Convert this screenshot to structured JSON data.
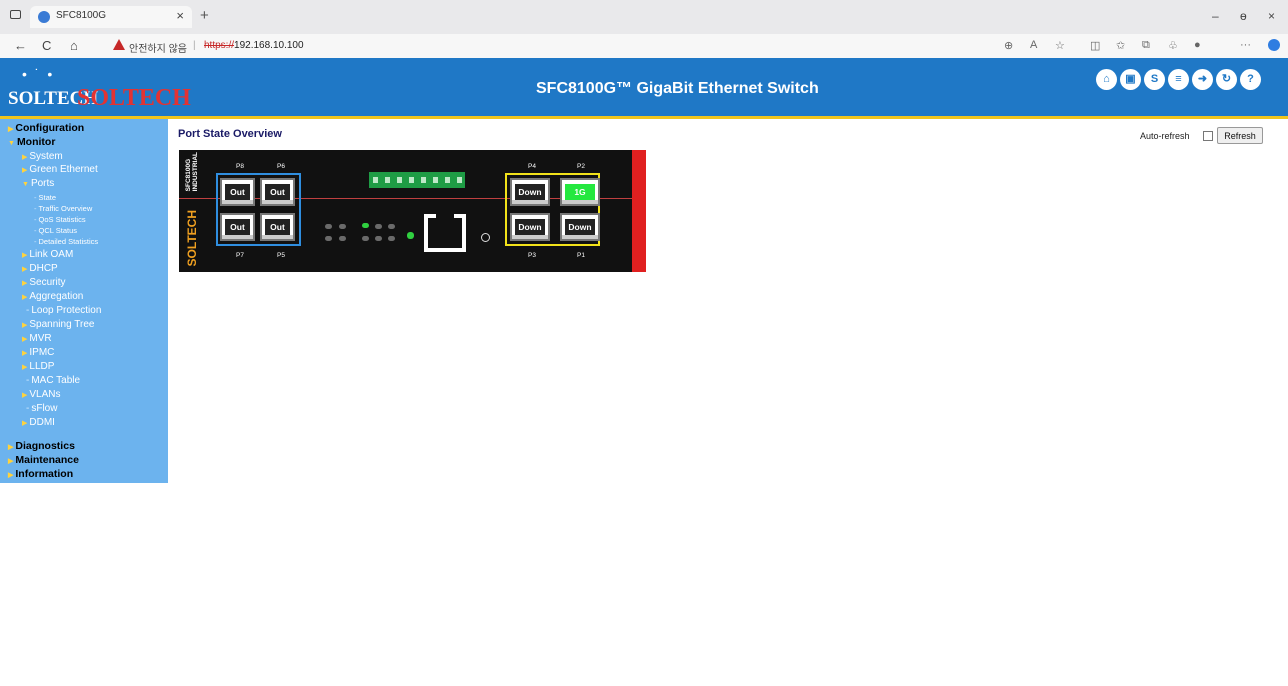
{
  "browser": {
    "tab_title": "SFC8100G",
    "tab_close": "×",
    "new_tab": "+",
    "back": "←",
    "reload": "C",
    "home": "⌂",
    "security_warning": "안전하지 않음",
    "separator": "|",
    "url_scheme": "https://",
    "url_rest": "192.168.10.100",
    "minimize": "–",
    "restore": "ɵ",
    "close": "×",
    "more": "···"
  },
  "banner": {
    "logo_dots": "• ˙ •",
    "logo_white": "SOLTECH",
    "logo_red": "SOLTECH",
    "title": "SFC8100G™ GigaBit Ethernet Switch",
    "icons": [
      {
        "name": "home-icon",
        "glyph": "⌂"
      },
      {
        "name": "save-icon",
        "glyph": "▣"
      },
      {
        "name": "ring-icon",
        "glyph": "S"
      },
      {
        "name": "dev-icon",
        "glyph": "≡"
      },
      {
        "name": "logout-icon",
        "glyph": "➜"
      },
      {
        "name": "refresh-icon",
        "glyph": "↻"
      },
      {
        "name": "help-icon",
        "glyph": "?"
      }
    ]
  },
  "sidebar": {
    "configuration": "Configuration",
    "monitor": "Monitor",
    "system": "System",
    "green_ethernet": "Green Ethernet",
    "ports": "Ports",
    "state": "State",
    "traffic_overview": "Traffic Overview",
    "qos_statistics": "QoS Statistics",
    "qcl_status": "QCL Status",
    "detailed_statistics": "Detailed Statistics",
    "link_oam": "Link OAM",
    "dhcp": "DHCP",
    "security": "Security",
    "aggregation": "Aggregation",
    "loop_protection": "Loop Protection",
    "spanning_tree": "Spanning Tree",
    "mvr": "MVR",
    "ipmc": "IPMC",
    "lldp": "LLDP",
    "mac_table": "MAC Table",
    "vlans": "VLANs",
    "sflow": "sFlow",
    "ddmi": "DDMI",
    "diagnostics": "Diagnostics",
    "maintenance": "Maintenance",
    "information": "Information"
  },
  "main": {
    "title": "Port State Overview",
    "auto_refresh_label": "Auto-refresh",
    "refresh_button": "Refresh"
  },
  "panel": {
    "model_line1": "SFC8100G",
    "model_line2": "INDUSTRIAL",
    "brand": "SOLTECH",
    "ports": {
      "P8": {
        "label": "P8",
        "state": "Out"
      },
      "P6": {
        "label": "P6",
        "state": "Out"
      },
      "P7": {
        "label": "P7",
        "state": "Out"
      },
      "P5": {
        "label": "P5",
        "state": "Out"
      },
      "P4": {
        "label": "P4",
        "state": "Down"
      },
      "P2": {
        "label": "P2",
        "state": "1G"
      },
      "P3": {
        "label": "P3",
        "state": "Down"
      },
      "P1": {
        "label": "P1",
        "state": "Down"
      }
    },
    "colors": {
      "sfp_group_border": "#2f8ee0",
      "rj45_group_border": "#f2e21a",
      "link_up": "#24e83f",
      "side_bar": "#e02020"
    }
  }
}
